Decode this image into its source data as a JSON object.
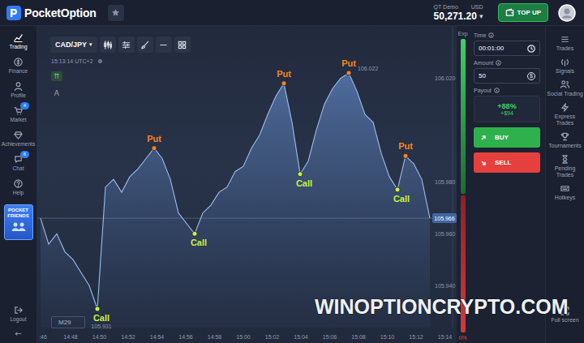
{
  "header": {
    "logo": "PocketOption",
    "account_mode": "QT Demo",
    "currency": "USD",
    "balance": "50,271.20",
    "balance_caret": "▾",
    "top_up": "TOP UP"
  },
  "left_nav": {
    "items": [
      {
        "label": "Trading",
        "selected": true,
        "badge": null
      },
      {
        "label": "Finance",
        "selected": false,
        "badge": null
      },
      {
        "label": "Profile",
        "selected": false,
        "badge": null
      },
      {
        "label": "Market",
        "selected": false,
        "badge": "4"
      },
      {
        "label": "Achievements",
        "selected": false,
        "badge": null
      },
      {
        "label": "Chat",
        "selected": false,
        "badge": "6"
      },
      {
        "label": "Help",
        "selected": false,
        "badge": null
      }
    ],
    "promo": [
      "POCKET",
      "FRIENDS"
    ],
    "logout": "Logout",
    "collapse": "←"
  },
  "chart": {
    "symbol": "CAD/JPY",
    "symbol_caret": "▾",
    "timestamp": "15:13:14 UTC+2",
    "side_tools": [
      "⇈",
      "A"
    ],
    "timeframe": "M29",
    "expiry_label": "Exp",
    "series": [
      {
        "name": "CAD/JPY",
        "values": [
          105.966,
          105.956,
          105.96,
          105.953,
          105.95,
          105.945,
          105.94,
          105.931,
          105.978,
          105.981,
          105.976,
          105.982,
          105.985,
          105.989,
          105.993,
          105.989,
          105.981,
          105.968,
          105.964,
          105.96,
          105.968,
          105.971,
          105.976,
          105.978,
          105.984,
          105.986,
          105.993,
          105.998,
          106.006,
          106.013,
          106.018,
          106.003,
          105.983,
          105.988,
          106.0,
          106.01,
          106.016,
          106.02,
          106.022,
          106.015,
          106.006,
          106.003,
          105.991,
          105.982,
          105.977,
          105.99,
          105.987,
          105.981,
          105.966
        ]
      }
    ],
    "y_ticks": [
      "106.020",
      "105.980",
      "105.960",
      "105.940"
    ],
    "x_ticks": [
      ":46",
      "14:48",
      "14:50",
      "14:52",
      "14:54",
      "14:56",
      "14:58",
      "15:00",
      "15:02",
      "15:04",
      "15:06",
      "15:08",
      "15:10",
      "15:12",
      "15:14"
    ],
    "current_price": "105.966",
    "markers": [
      {
        "kind": "call",
        "label": "Call",
        "index": 7,
        "color": "#c6f43c",
        "price": "105.931"
      },
      {
        "kind": "put",
        "label": "Put",
        "index": 14,
        "color": "#f7861f",
        "price": null
      },
      {
        "kind": "call",
        "label": "Call",
        "index": 19,
        "color": "#c6f43c",
        "price": null
      },
      {
        "kind": "put",
        "label": "Put",
        "index": 30,
        "color": "#f7861f",
        "price": null
      },
      {
        "kind": "call",
        "label": "Call",
        "index": 32,
        "color": "#c6f43c",
        "price": null
      },
      {
        "kind": "put",
        "label": "Put",
        "index": 38,
        "color": "#f7861f",
        "price": "106.022"
      },
      {
        "kind": "call",
        "label": "Call",
        "index": 44,
        "color": "#c6f43c",
        "price": null
      },
      {
        "kind": "put",
        "label": "Put",
        "index": 45,
        "color": "#f7861f",
        "price": null
      }
    ]
  },
  "sentiment": {
    "level": 0.53,
    "reading": "0%"
  },
  "trade_panel": {
    "time": {
      "label": "Time",
      "value": "00:01:00"
    },
    "amount": {
      "label": "Amount",
      "value": "50",
      "icon": "$"
    },
    "payout": {
      "label": "Payout",
      "percent": "+88%",
      "profit": "+$94"
    },
    "buy": "BUY",
    "sell": "SELL"
  },
  "right_nav": {
    "items": [
      "Trades",
      "Signals",
      "Social Trading",
      "Express Trades",
      "Tournaments",
      "Pending Trades",
      "Hotkeys"
    ],
    "fullscreen": "Full screen"
  },
  "watermark": "WINOPTIONCRYPTO.COM"
}
